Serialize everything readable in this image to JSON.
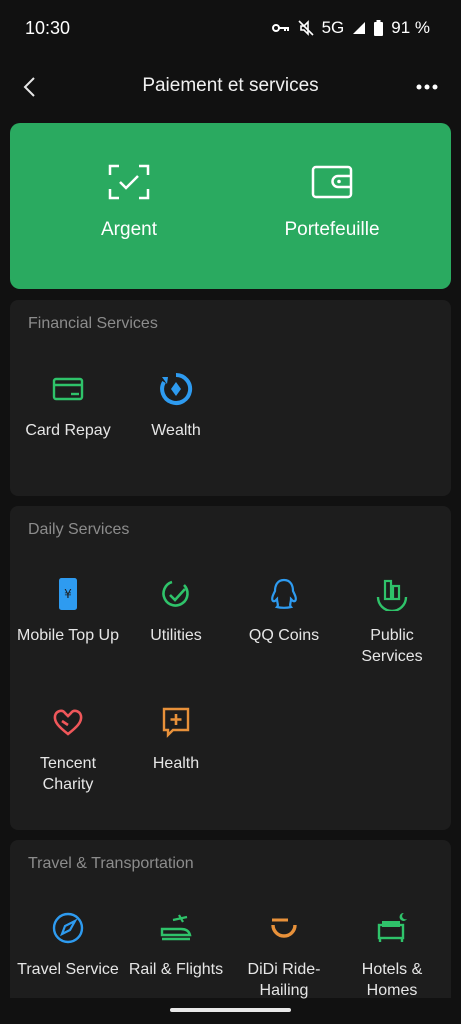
{
  "status": {
    "time": "10:30",
    "network": "5G",
    "battery": "91 %"
  },
  "nav": {
    "title": "Paiement et services"
  },
  "hero": {
    "money_label": "Argent",
    "wallet_label": "Portefeuille"
  },
  "financial": {
    "title": "Financial Services",
    "items": [
      {
        "label": "Card Repay"
      },
      {
        "label": "Wealth"
      }
    ]
  },
  "daily": {
    "title": "Daily Services",
    "items": [
      {
        "label": "Mobile Top Up"
      },
      {
        "label": "Utilities"
      },
      {
        "label": "QQ Coins"
      },
      {
        "label": "Public Services"
      },
      {
        "label": "Tencent Charity"
      },
      {
        "label": "Health"
      }
    ]
  },
  "travel": {
    "title": "Travel & Transportation",
    "items": [
      {
        "label": "Travel Service"
      },
      {
        "label": "Rail & Flights"
      },
      {
        "label": "DiDi Ride-Hailing"
      },
      {
        "label": "Hotels & Homes"
      }
    ]
  },
  "colors": {
    "accent": "#2aaa60",
    "blue": "#2e9bf0",
    "green": "#2fc36a",
    "red": "#f0575a",
    "orange": "#e8913a",
    "card": "#1d1d1d",
    "bg": "#111111"
  }
}
